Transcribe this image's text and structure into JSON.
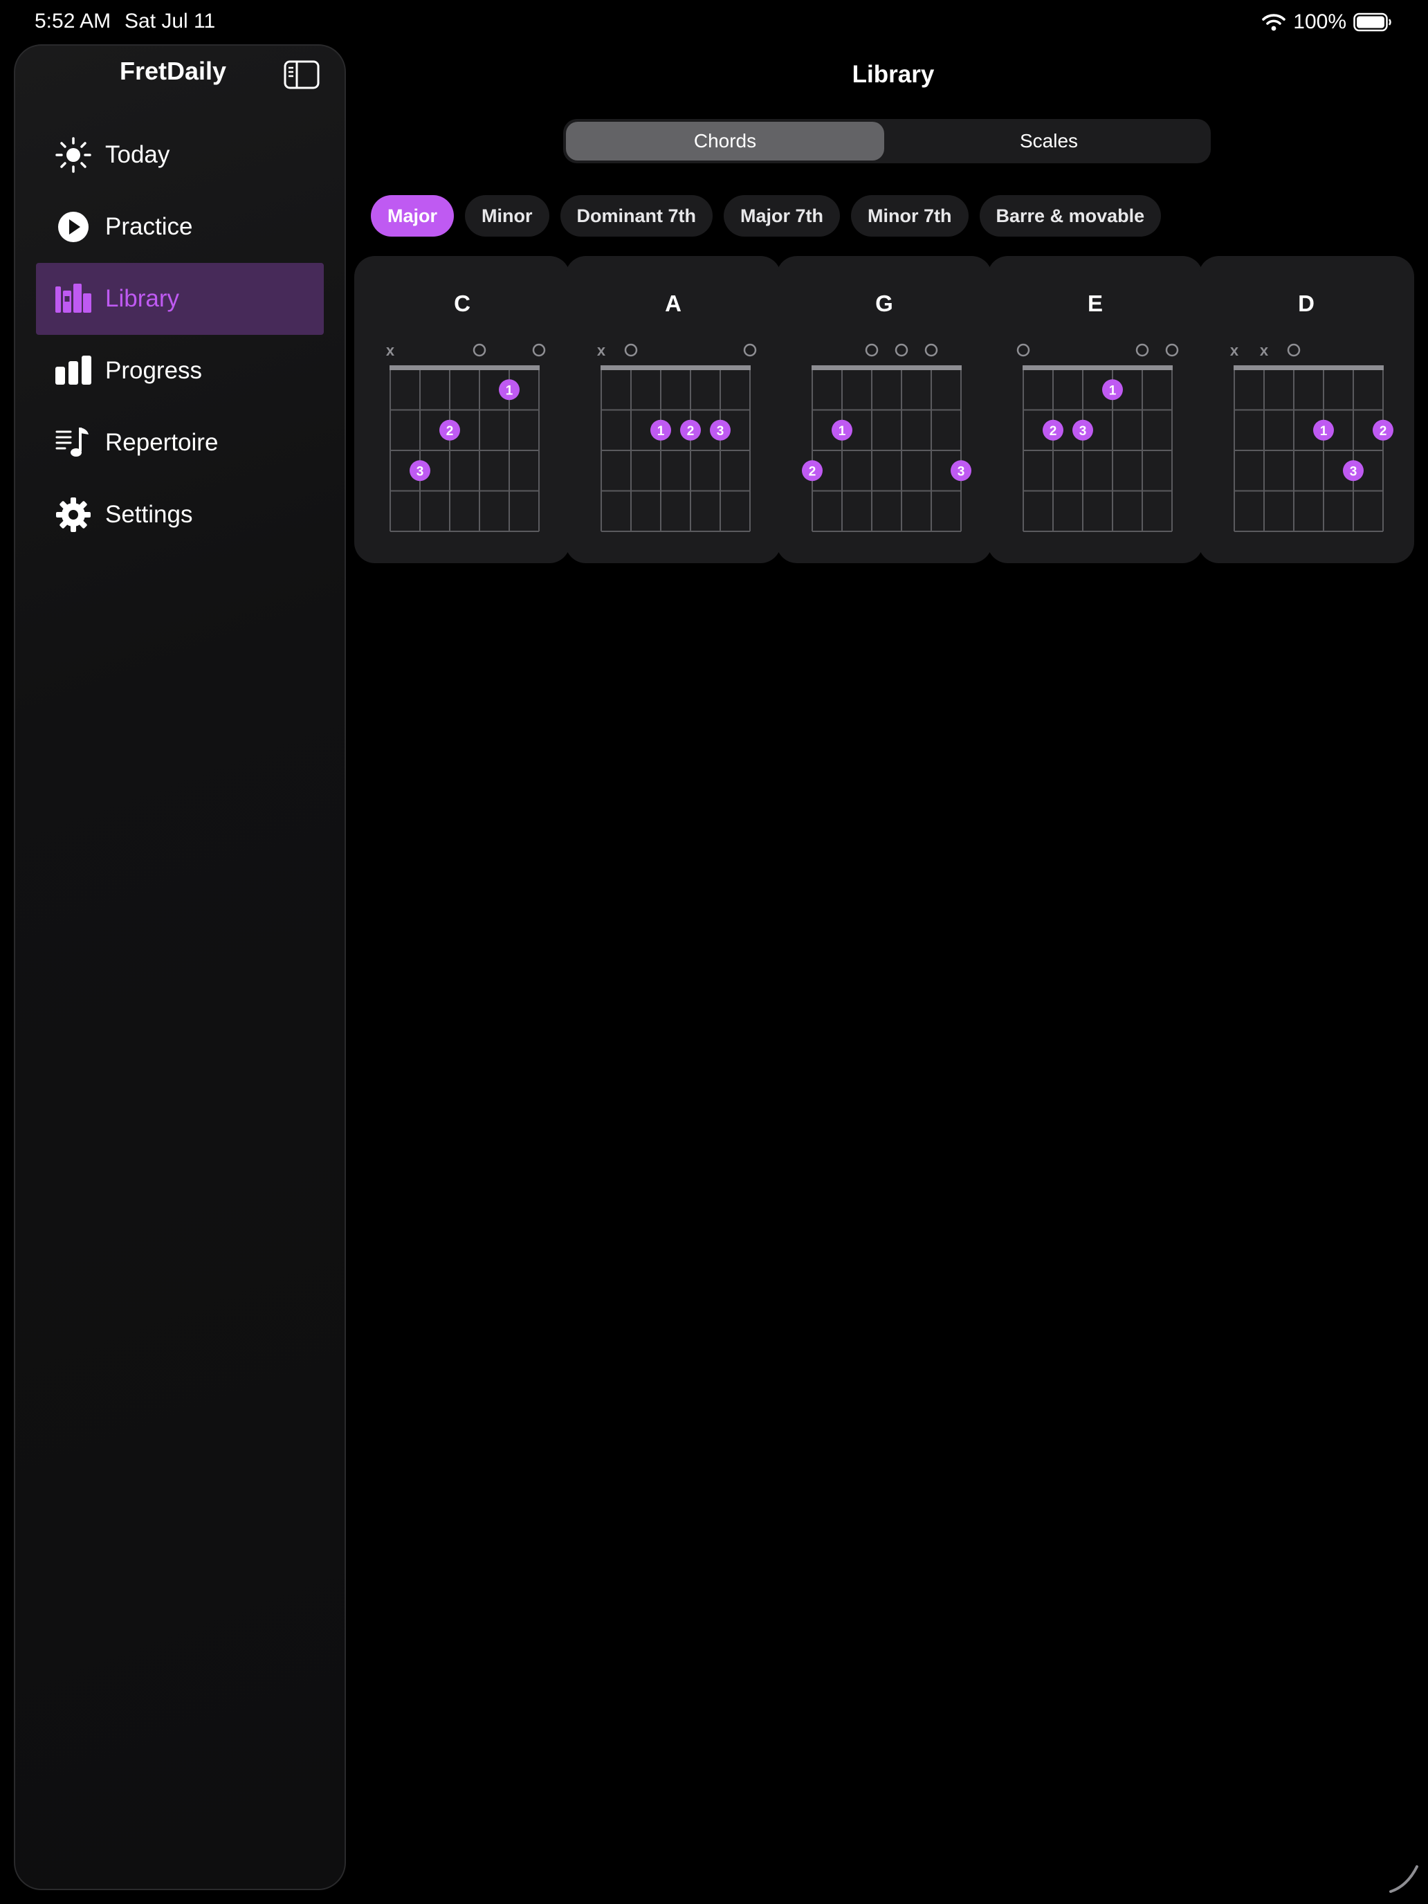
{
  "status_bar": {
    "time": "5:52 AM",
    "date": "Sat Jul 11",
    "battery": "100%"
  },
  "sidebar": {
    "title": "FretDaily",
    "toggle_icon": "sidebar-toggle-icon",
    "items": [
      {
        "label": "Today",
        "icon": "sun-icon",
        "active": false
      },
      {
        "label": "Practice",
        "icon": "play-circle-icon",
        "active": false
      },
      {
        "label": "Library",
        "icon": "books-icon",
        "active": true
      },
      {
        "label": "Progress",
        "icon": "bar-chart-icon",
        "active": false
      },
      {
        "label": "Repertoire",
        "icon": "music-list-icon",
        "active": false
      },
      {
        "label": "Settings",
        "icon": "gear-icon",
        "active": false
      }
    ]
  },
  "main": {
    "title": "Library",
    "segments": [
      {
        "label": "Chords",
        "selected": true
      },
      {
        "label": "Scales",
        "selected": false
      }
    ],
    "filters": [
      {
        "label": "Major",
        "active": true
      },
      {
        "label": "Minor",
        "active": false
      },
      {
        "label": "Dominant 7th",
        "active": false
      },
      {
        "label": "Major 7th",
        "active": false
      },
      {
        "label": "Minor 7th",
        "active": false
      },
      {
        "label": "Barre & movable",
        "active": false
      }
    ],
    "chords": [
      {
        "name": "C",
        "markers": [
          "x",
          "",
          "",
          "o",
          "",
          "o"
        ],
        "dots": [
          {
            "string": 5,
            "fret": 1,
            "finger": "1"
          },
          {
            "string": 3,
            "fret": 2,
            "finger": "2"
          },
          {
            "string": 2,
            "fret": 3,
            "finger": "3"
          }
        ]
      },
      {
        "name": "A",
        "markers": [
          "x",
          "o",
          "",
          "",
          "",
          "o"
        ],
        "dots": [
          {
            "string": 3,
            "fret": 2,
            "finger": "1"
          },
          {
            "string": 4,
            "fret": 2,
            "finger": "2"
          },
          {
            "string": 5,
            "fret": 2,
            "finger": "3"
          }
        ]
      },
      {
        "name": "G",
        "markers": [
          "",
          "",
          "o",
          "o",
          "o",
          ""
        ],
        "dots": [
          {
            "string": 2,
            "fret": 2,
            "finger": "1"
          },
          {
            "string": 1,
            "fret": 3,
            "finger": "2"
          },
          {
            "string": 6,
            "fret": 3,
            "finger": "3"
          }
        ]
      },
      {
        "name": "E",
        "markers": [
          "o",
          "",
          "",
          "",
          "o",
          "o"
        ],
        "dots": [
          {
            "string": 4,
            "fret": 1,
            "finger": "1"
          },
          {
            "string": 2,
            "fret": 2,
            "finger": "2"
          },
          {
            "string": 3,
            "fret": 2,
            "finger": "3"
          }
        ]
      },
      {
        "name": "D",
        "markers": [
          "x",
          "x",
          "o",
          "",
          "",
          ""
        ],
        "dots": [
          {
            "string": 4,
            "fret": 2,
            "finger": "1"
          },
          {
            "string": 6,
            "fret": 2,
            "finger": "2"
          },
          {
            "string": 5,
            "fret": 3,
            "finger": "3"
          }
        ]
      }
    ]
  },
  "colors": {
    "accent": "#bf5af2",
    "active_nav_bg": "#472a59",
    "card_bg": "#1c1c1e",
    "grid_line": "#5a5a5e",
    "nut": "#8e8e93",
    "marker": "#8e8e93"
  }
}
